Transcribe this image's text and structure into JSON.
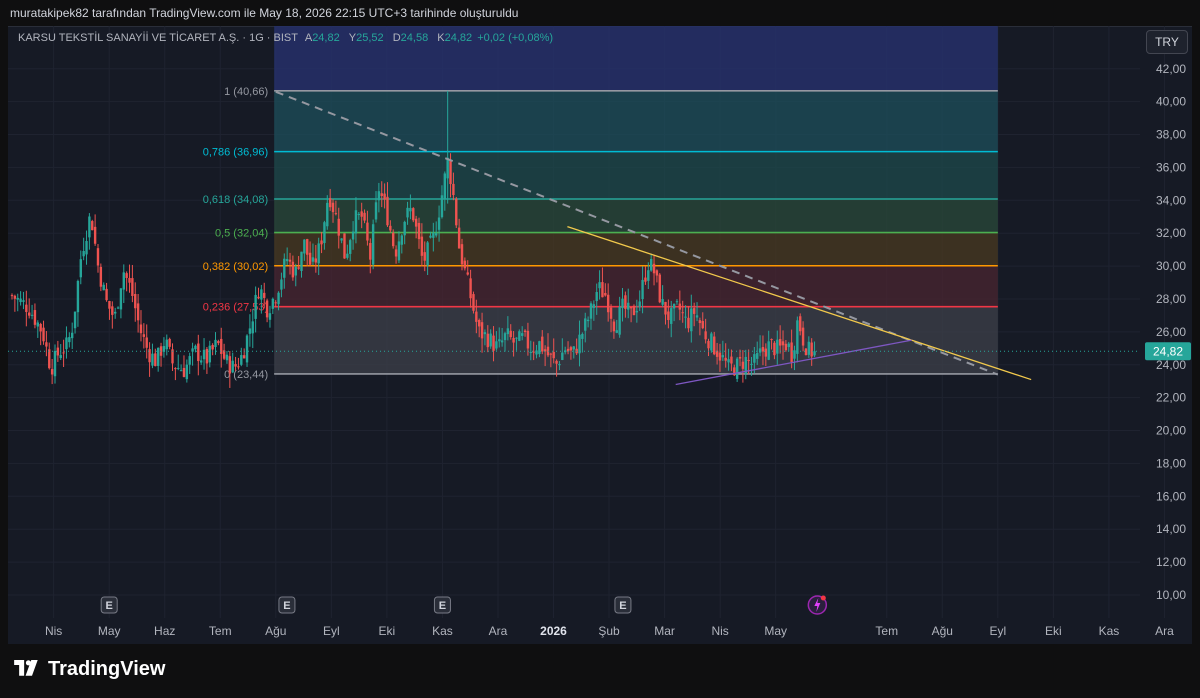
{
  "header": {
    "attribution": "muratakipek82 tarafından TradingView.com ile May 18, 2026 22:15 UTC+3 tarihinde oluşturuldu"
  },
  "legend": {
    "symbol": "KARSU TEKSTİL SANAYİİ VE TİCARET A.Ş. · 1G · BIST",
    "a_key": "A",
    "a_val": "24,82",
    "y_key": "Y",
    "y_val": "25,52",
    "d_key": "D",
    "d_val": "24,58",
    "k_key": "K",
    "k_val": "24,82",
    "change": "+0,02 (+0,08%)"
  },
  "currency_button": "TRY",
  "brand": {
    "name": "TradingView"
  },
  "colors": {
    "background": "#161a25",
    "up": "#26a69a",
    "down": "#ef5350",
    "grid": "#1f2330",
    "axis_text": "#b2b5be",
    "price_badge": "#26a69a"
  },
  "chart_data": {
    "type": "candlestick",
    "instrument": "KARSU TEKSTİL SANAYİİ VE TİCARET A.Ş.",
    "timeframe": "1G",
    "exchange": "BIST",
    "last_price": 24.82,
    "last_price_label": "24,82",
    "ylim": [
      8.6,
      44.6
    ],
    "y_ticks": [
      10,
      12,
      14,
      16,
      18,
      20,
      22,
      24,
      26,
      28,
      30,
      32,
      34,
      36,
      38,
      40,
      42
    ],
    "y_tick_labels": [
      "10,00",
      "12,00",
      "14,00",
      "16,00",
      "18,00",
      "20,00",
      "22,00",
      "24,00",
      "26,00",
      "28,00",
      "30,00",
      "32,00",
      "34,00",
      "36,00",
      "38,00",
      "40,00",
      "42,00"
    ],
    "x_ticks": [
      {
        "label": "Nis",
        "t": 0.75
      },
      {
        "label": "May",
        "t": 1.75
      },
      {
        "label": "Haz",
        "t": 2.75
      },
      {
        "label": "Tem",
        "t": 3.75
      },
      {
        "label": "Ağu",
        "t": 4.75
      },
      {
        "label": "Eyl",
        "t": 5.75
      },
      {
        "label": "Eki",
        "t": 6.75
      },
      {
        "label": "Kas",
        "t": 7.75
      },
      {
        "label": "Ara",
        "t": 8.75
      },
      {
        "label": "2026",
        "t": 9.75,
        "bold": true
      },
      {
        "label": "Şub",
        "t": 10.75
      },
      {
        "label": "Mar",
        "t": 11.75
      },
      {
        "label": "Nis",
        "t": 12.75
      },
      {
        "label": "May",
        "t": 13.75
      },
      {
        "label": "Tem",
        "t": 15.75
      },
      {
        "label": "Ağu",
        "t": 16.75
      },
      {
        "label": "Eyl",
        "t": 17.75
      },
      {
        "label": "Eki",
        "t": 18.75
      },
      {
        "label": "Kas",
        "t": 19.75
      },
      {
        "label": "Ara",
        "t": 20.75
      }
    ],
    "close_path": [
      [
        0.0,
        28.2
      ],
      [
        0.3,
        27.5
      ],
      [
        0.55,
        26.0
      ],
      [
        0.7,
        23.8
      ],
      [
        0.85,
        24.8
      ],
      [
        1.0,
        25.2
      ],
      [
        1.1,
        26.5
      ],
      [
        1.25,
        30.8
      ],
      [
        1.42,
        33.2
      ],
      [
        1.55,
        30.0
      ],
      [
        1.7,
        27.8
      ],
      [
        1.85,
        26.8
      ],
      [
        2.0,
        29.8
      ],
      [
        2.15,
        28.5
      ],
      [
        2.3,
        26.2
      ],
      [
        2.45,
        24.8
      ],
      [
        2.6,
        24.2
      ],
      [
        2.75,
        25.5
      ],
      [
        2.9,
        24.0
      ],
      [
        3.1,
        23.7
      ],
      [
        3.3,
        24.8
      ],
      [
        3.5,
        24.3
      ],
      [
        3.7,
        25.3
      ],
      [
        3.85,
        24.2
      ],
      [
        4.0,
        23.8
      ],
      [
        4.15,
        24.6
      ],
      [
        4.3,
        26.5
      ],
      [
        4.45,
        28.8
      ],
      [
        4.6,
        27.4
      ],
      [
        4.75,
        28.3
      ],
      [
        4.95,
        30.5
      ],
      [
        5.1,
        29.5
      ],
      [
        5.25,
        31.5
      ],
      [
        5.4,
        29.8
      ],
      [
        5.55,
        31.2
      ],
      [
        5.7,
        34.5
      ],
      [
        5.85,
        32.8
      ],
      [
        6.0,
        30.5
      ],
      [
        6.15,
        32.8
      ],
      [
        6.3,
        33.0
      ],
      [
        6.45,
        30.5
      ],
      [
        6.6,
        34.8
      ],
      [
        6.75,
        33.2
      ],
      [
        6.9,
        30.8
      ],
      [
        7.05,
        32.8
      ],
      [
        7.2,
        33.5
      ],
      [
        7.4,
        30.2
      ],
      [
        7.6,
        31.8
      ],
      [
        7.75,
        34.5
      ],
      [
        7.85,
        36.5
      ],
      [
        7.95,
        34.2
      ],
      [
        8.05,
        31.2
      ],
      [
        8.2,
        29.0
      ],
      [
        8.4,
        26.0
      ],
      [
        8.55,
        25.7
      ],
      [
        8.75,
        25.0
      ],
      [
        8.9,
        25.8
      ],
      [
        9.05,
        25.3
      ],
      [
        9.2,
        25.6
      ],
      [
        9.35,
        25.0
      ],
      [
        9.5,
        25.3
      ],
      [
        9.65,
        24.6
      ],
      [
        9.8,
        24.0
      ],
      [
        9.95,
        25.0
      ],
      [
        10.1,
        24.6
      ],
      [
        10.25,
        25.8
      ],
      [
        10.4,
        27.0
      ],
      [
        10.55,
        28.7
      ],
      [
        10.7,
        28.2
      ],
      [
        10.85,
        26.4
      ],
      [
        11.0,
        27.5
      ],
      [
        11.15,
        27.0
      ],
      [
        11.3,
        28.0
      ],
      [
        11.45,
        30.2
      ],
      [
        11.55,
        29.8
      ],
      [
        11.7,
        27.7
      ],
      [
        11.85,
        26.8
      ],
      [
        12.0,
        27.5
      ],
      [
        12.15,
        26.5
      ],
      [
        12.3,
        27.3
      ],
      [
        12.45,
        26.0
      ],
      [
        12.6,
        25.3
      ],
      [
        12.75,
        24.6
      ],
      [
        12.9,
        23.8
      ],
      [
        13.05,
        23.9
      ],
      [
        13.2,
        24.3
      ],
      [
        13.35,
        24.0
      ],
      [
        13.5,
        24.8
      ],
      [
        13.65,
        25.2
      ],
      [
        13.8,
        24.9
      ],
      [
        13.95,
        25.3
      ],
      [
        14.05,
        24.6
      ],
      [
        14.15,
        26.8
      ],
      [
        14.25,
        25.5
      ],
      [
        14.35,
        24.8
      ],
      [
        14.45,
        24.82
      ]
    ],
    "spike": {
      "t": 7.85,
      "high": 40.66,
      "low": 33.8
    },
    "fibonacci": {
      "t_start": 4.72,
      "t_end": 17.75,
      "levels": [
        {
          "ratio": "1",
          "value": 40.66,
          "label": "1 (40,66)",
          "color": "#9598a1",
          "fill": "#3d4049"
        },
        {
          "ratio": "0.786",
          "value": 36.96,
          "label": "0,786 (36,96)",
          "color": "#00bcd4",
          "fill": "#1d4f5b"
        },
        {
          "ratio": "0.618",
          "value": 34.08,
          "label": "0,618 (34,08)",
          "color": "#26a69a",
          "fill": "#1d4a4b"
        },
        {
          "ratio": "0.5",
          "value": 32.04,
          "label": "0,5 (32,04)",
          "color": "#4caf50",
          "fill": "#2a4a3a"
        },
        {
          "ratio": "0.382",
          "value": 30.02,
          "label": "0,382 (30,02)",
          "color": "#ff9800",
          "fill": "#4a3a20"
        },
        {
          "ratio": "0.236",
          "value": 27.53,
          "label": "0,236 (27,53)",
          "color": "#f23645",
          "fill": "#4a2530"
        },
        {
          "ratio": "0",
          "value": 23.44,
          "label": "0 (23,44)",
          "color": "#9598a1",
          "fill": "#3d4049"
        }
      ],
      "extension_top_fill": "#26306a"
    },
    "trendlines": [
      {
        "name": "diagonal-dashed",
        "color": "#9598a1",
        "dashed": true,
        "from": [
          4.75,
          40.6
        ],
        "to": [
          17.75,
          23.4
        ]
      },
      {
        "name": "descending-resistance",
        "color": "#f2c94c",
        "dashed": false,
        "from": [
          10.0,
          32.4
        ],
        "to": [
          18.35,
          23.1
        ]
      },
      {
        "name": "ascending-support",
        "color": "#7e57c2",
        "dashed": false,
        "from": [
          11.95,
          22.8
        ],
        "to": [
          16.2,
          25.5
        ]
      }
    ],
    "earnings_markers": [
      1.75,
      4.95,
      7.75,
      11.0
    ],
    "dividend_marker": 14.5
  }
}
